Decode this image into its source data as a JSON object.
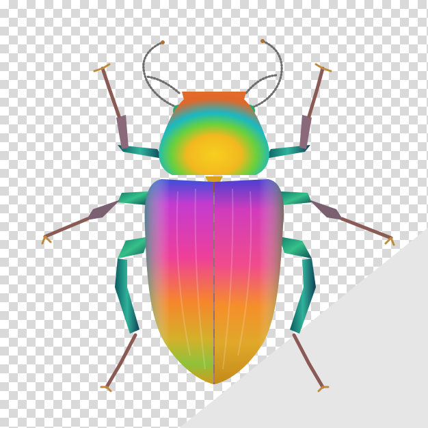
{
  "image": {
    "subject": "beetle-icon",
    "background": "transparency-checkerboard",
    "colors": {
      "checker_light": "#ffffff",
      "checker_dark": "#d9d9d9",
      "corner_wedge": "#e6e6e6",
      "leg_metal": "#1a8f7a",
      "leg_tarsus": "#8a5a55",
      "elytra_magenta": "#e0399d",
      "elytra_orange": "#f28a1e",
      "elytra_gold": "#d9a21c",
      "pronotum_green": "#3cc85a",
      "pronotum_cyan": "#18b4c8",
      "pronotum_yellow": "#f2c623"
    }
  }
}
